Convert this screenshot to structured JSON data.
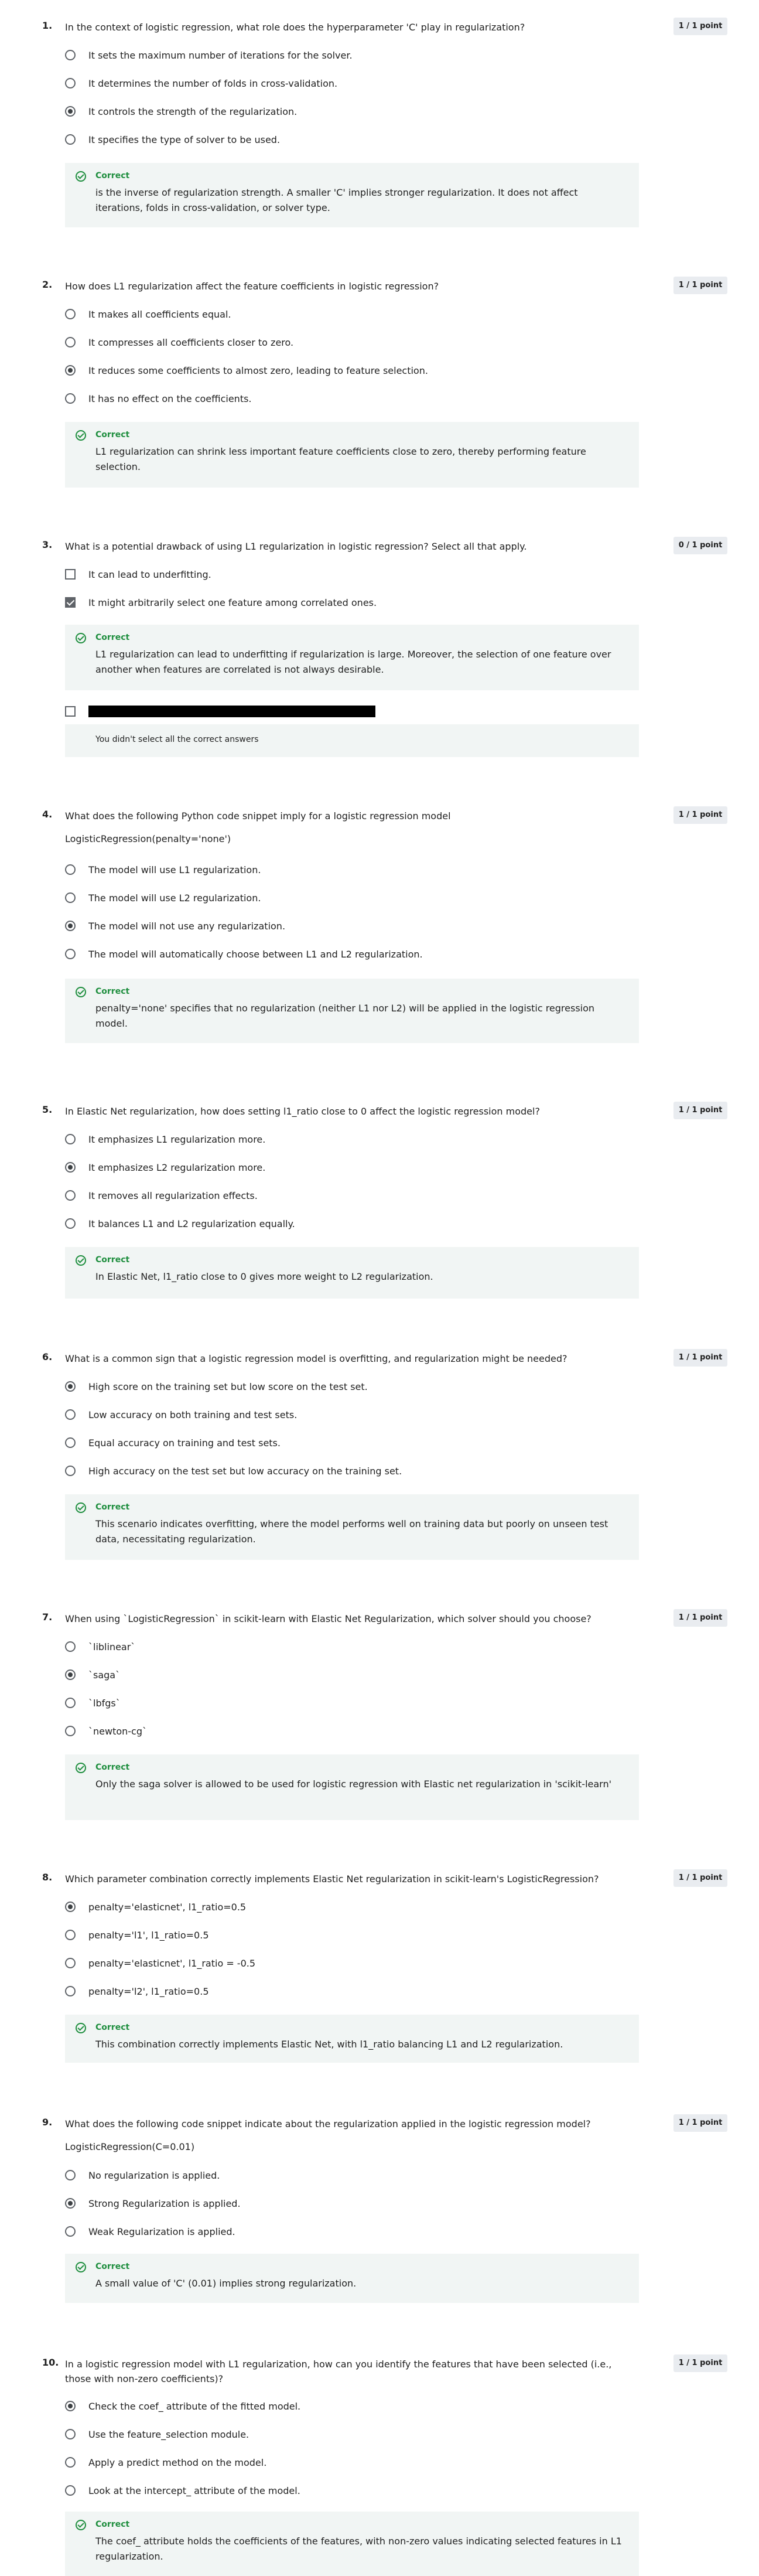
{
  "questions": [
    {
      "number": "1.",
      "text": "In the context of logistic regression, what role does the hyperparameter 'C' play in regularization?",
      "points": "1 / 1 point",
      "options": [
        "It sets the maximum number of iterations for the solver.",
        "It determines the number of folds in cross-validation.",
        "It controls the strength of the regularization.",
        "It specifies the type of solver to be used."
      ],
      "selected": 2,
      "feedback_title": "Correct",
      "feedback_text": "is the inverse of regularization strength. A smaller 'C' implies stronger regularization. It does not affect iterations, folds in cross-validation, or solver type."
    },
    {
      "number": "2.",
      "text": "How does L1 regularization affect the feature coefficients in logistic regression?",
      "points": "1 / 1 point",
      "options": [
        "It makes all coefficients equal.",
        "It compresses all coefficients closer to zero.",
        "It reduces some coefficients to almost zero, leading to feature selection.",
        "It has no effect on the coefficients."
      ],
      "selected": 2,
      "feedback_title": "Correct",
      "feedback_text": "L1 regularization can shrink less important feature coefficients close to zero, thereby performing feature selection."
    },
    {
      "number": "3.",
      "text": "What is a potential drawback of using L1 regularization in logistic regression? Select all that apply.",
      "points": "0 / 1 point",
      "options": [
        "It can lead to underfitting.",
        "It might arbitrarily select one feature among correlated ones."
      ],
      "checked": [
        false,
        true
      ],
      "feedback_title": "Correct",
      "feedback_text": "L1 regularization can lead to underfitting if regularization is large. Moreover, the selection of one feature over another when features are correlated is not always desirable.",
      "summary": "You didn't select all the correct answers"
    },
    {
      "number": "4.",
      "text": "What does the following Python code snippet imply for a logistic regression model",
      "code": "LogisticRegression(penalty='none')",
      "points": "1 / 1 point",
      "options": [
        "The model will use L1 regularization.",
        "The model will use L2 regularization.",
        "The model will not use any regularization.",
        "The model will automatically choose between L1 and L2 regularization."
      ],
      "selected": 2,
      "feedback_title": "Correct",
      "feedback_text": "penalty='none' specifies that no regularization (neither L1 nor L2) will be applied in the logistic regression model."
    },
    {
      "number": "5.",
      "text": "In Elastic Net regularization, how does setting l1_ratio close to 0 affect the logistic regression model?",
      "points": "1 / 1 point",
      "options": [
        "It emphasizes L1 regularization more.",
        "It emphasizes L2 regularization more.",
        "It removes all regularization effects.",
        "It balances L1 and L2 regularization equally."
      ],
      "selected": 1,
      "feedback_title": "Correct",
      "feedback_text": "In Elastic Net, l1_ratio close to 0 gives more weight to L2 regularization."
    },
    {
      "number": "6.",
      "text": "What is a common sign that a logistic regression model is overfitting, and regularization might be needed?",
      "points": "1 / 1 point",
      "options": [
        "High score on the training set but low score on the test set.",
        "Low accuracy on both training and test sets.",
        "Equal accuracy on training and test sets.",
        "High accuracy on the test set but low accuracy on the training set."
      ],
      "selected": 0,
      "feedback_title": "Correct",
      "feedback_text": "This scenario indicates overfitting, where the model performs well on training data but poorly on unseen test data, necessitating regularization."
    },
    {
      "number": "7.",
      "text": "When using `LogisticRegression` in scikit-learn with Elastic Net Regularization, which solver should you choose?",
      "points": "1 / 1 point",
      "options": [
        "`liblinear`",
        "`saga`",
        "`lbfgs`",
        "`newton-cg`"
      ],
      "selected": 1,
      "feedback_title": "Correct",
      "feedback_text": "Only the saga solver is allowed to be used for logistic regression with Elastic net regularization in 'scikit-learn'"
    },
    {
      "number": "8.",
      "text": "Which parameter combination correctly implements Elastic Net regularization in scikit-learn's LogisticRegression?",
      "points": "1 / 1 point",
      "options": [
        "penalty='elasticnet', l1_ratio=0.5",
        "penalty='l1', l1_ratio=0.5",
        "penalty='elasticnet', l1_ratio = -0.5",
        "penalty='l2', l1_ratio=0.5"
      ],
      "selected": 0,
      "feedback_title": "Correct",
      "feedback_text": "This combination correctly implements Elastic Net, with l1_ratio balancing L1 and L2 regularization."
    },
    {
      "number": "9.",
      "text": "What does the following code snippet indicate about the regularization applied in the logistic regression model?",
      "code": "LogisticRegression(C=0.01)",
      "points": "1 / 1 point",
      "options": [
        "No regularization is applied.",
        "Strong Regularization is applied.",
        "Weak Regularization is applied."
      ],
      "selected": 1,
      "feedback_title": "Correct",
      "feedback_text": "A small value of 'C' (0.01) implies strong regularization."
    },
    {
      "number": "10.",
      "text": "In a logistic regression model with L1 regularization, how can you identify the features that have been selected (i.e., those with non-zero coefficients)?",
      "points": "1 / 1 point",
      "options": [
        "Check the coef_ attribute of the fitted model.",
        "Use the feature_selection module.",
        "Apply a predict method on the model.",
        "Look at the intercept_ attribute of the model."
      ],
      "selected": 0,
      "feedback_title": "Correct",
      "feedback_text": "The coef_ attribute holds the coefficients of the features, with non-zero values indicating selected features in L1 regularization."
    }
  ]
}
